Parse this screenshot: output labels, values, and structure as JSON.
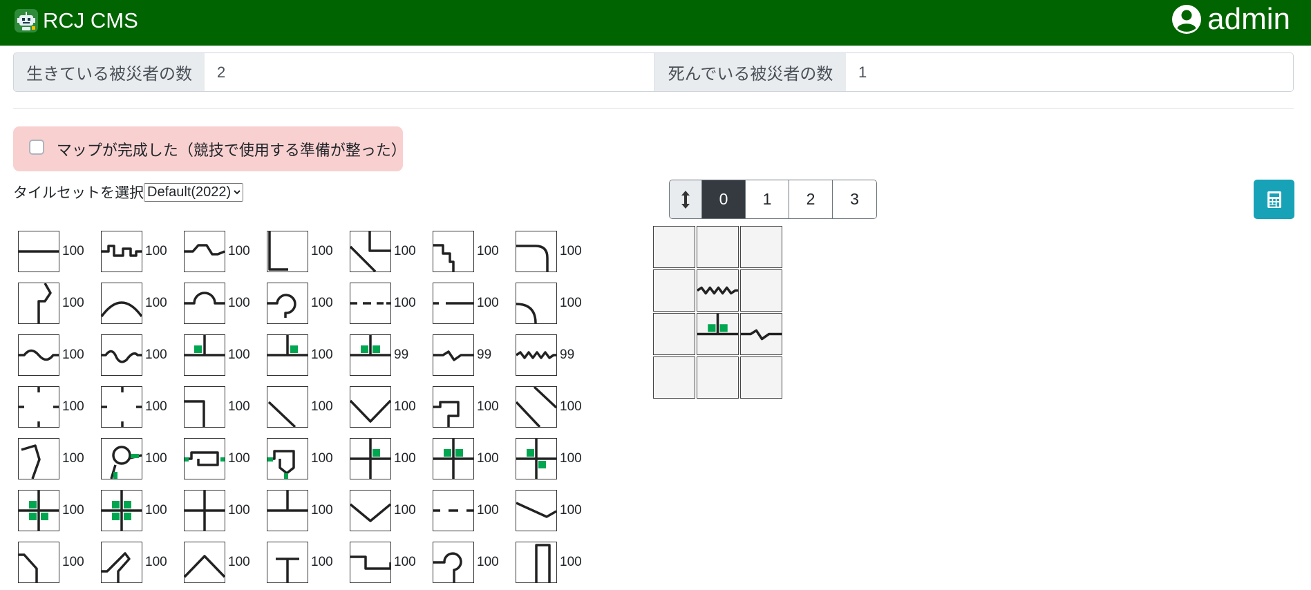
{
  "app": {
    "title": "RCJ CMS",
    "user": "admin"
  },
  "victims": {
    "alive_label": "生きている被災者の数",
    "alive_value": "2",
    "dead_label": "死んでいる被災者の数",
    "dead_value": "1"
  },
  "finished": {
    "label": "マップが完成した（競技で使用する準備が整った）",
    "checked": false
  },
  "tileset": {
    "label": "タイルセットを選択",
    "selected": "Default(2022)"
  },
  "tiles": [
    {
      "icon": "tile-straight-line",
      "count": "100"
    },
    {
      "icon": "tile-zigzag-bump",
      "count": "100"
    },
    {
      "icon": "tile-trapezoid-bump",
      "count": "100"
    },
    {
      "icon": "tile-corner-left-bottom",
      "count": "100"
    },
    {
      "icon": "tile-diagonal-corner",
      "count": "100"
    },
    {
      "icon": "tile-step-down",
      "count": "100"
    },
    {
      "icon": "tile-curve-right-down",
      "count": "100"
    },
    {
      "icon": "tile-step-diagonal",
      "count": "100"
    },
    {
      "icon": "tile-arch-line",
      "count": "100"
    },
    {
      "icon": "tile-semicircle-hump",
      "count": "100"
    },
    {
      "icon": "tile-loop-hook",
      "count": "100"
    },
    {
      "icon": "tile-dashed-line",
      "count": "100"
    },
    {
      "icon": "tile-gap-line",
      "count": "100"
    },
    {
      "icon": "tile-quarter-curve",
      "count": "100"
    },
    {
      "icon": "tile-wave-line",
      "count": "100"
    },
    {
      "icon": "tile-double-wave",
      "count": "100"
    },
    {
      "icon": "tile-t-junction-green-left",
      "count": "100"
    },
    {
      "icon": "tile-t-junction-green-right",
      "count": "100"
    },
    {
      "icon": "tile-t-junction-green-both",
      "count": "99"
    },
    {
      "icon": "tile-spike-line",
      "count": "99"
    },
    {
      "icon": "tile-zigzag-line",
      "count": "99"
    },
    {
      "icon": "tile-broken-cross",
      "count": "100"
    },
    {
      "icon": "tile-broken-line",
      "count": "100"
    },
    {
      "icon": "tile-corner-gap",
      "count": "100"
    },
    {
      "icon": "tile-diagonal-line",
      "count": "100"
    },
    {
      "icon": "tile-v-shape",
      "count": "100"
    },
    {
      "icon": "tile-hook-loop",
      "count": "100"
    },
    {
      "icon": "tile-double-diagonal",
      "count": "100"
    },
    {
      "icon": "tile-polyline",
      "count": "100"
    },
    {
      "icon": "tile-roundabout",
      "count": "100"
    },
    {
      "icon": "tile-rectangle-loop",
      "count": "100"
    },
    {
      "icon": "tile-pentagon-loop",
      "count": "100"
    },
    {
      "icon": "tile-cross-green-tr",
      "count": "100"
    },
    {
      "icon": "tile-cross-green-top",
      "count": "100"
    },
    {
      "icon": "tile-cross-green-diag",
      "count": "100"
    },
    {
      "icon": "tile-cross-green-bottom",
      "count": "100"
    },
    {
      "icon": "tile-cross-green-all",
      "count": "100"
    },
    {
      "icon": "tile-cross",
      "count": "100"
    },
    {
      "icon": "tile-t-junction",
      "count": "100"
    },
    {
      "icon": "tile-v-dip",
      "count": "100"
    },
    {
      "icon": "tile-gap-dash",
      "count": "100"
    },
    {
      "icon": "tile-slanted-line",
      "count": "100"
    },
    {
      "icon": "tile-corner-diagonal",
      "count": "100"
    },
    {
      "icon": "tile-diagonal-step",
      "count": "100"
    },
    {
      "icon": "tile-caret",
      "count": "100"
    },
    {
      "icon": "tile-t-bottom",
      "count": "100"
    },
    {
      "icon": "tile-square-dip",
      "count": "100"
    },
    {
      "icon": "tile-hook-s",
      "count": "100"
    },
    {
      "icon": "tile-u-bracket",
      "count": "100"
    }
  ],
  "layers": {
    "toggle_icon": "arrows-vertical-icon",
    "items": [
      "0",
      "1",
      "2",
      "3"
    ],
    "active": "0"
  },
  "calculator": {
    "icon": "calculator-icon"
  },
  "map": {
    "cols": 3,
    "rows": 4,
    "cells": [
      "empty",
      "empty",
      "empty",
      "empty",
      "tile-zigzag-line",
      "empty",
      "empty",
      "tile-t-junction-green-both",
      "tile-spike-line",
      "empty",
      "empty",
      "empty"
    ]
  },
  "colors": {
    "navbar": "#006400",
    "green": "#00a650",
    "alert": "#f8d0d0",
    "info": "#17a2b8",
    "dark": "#343a40"
  }
}
